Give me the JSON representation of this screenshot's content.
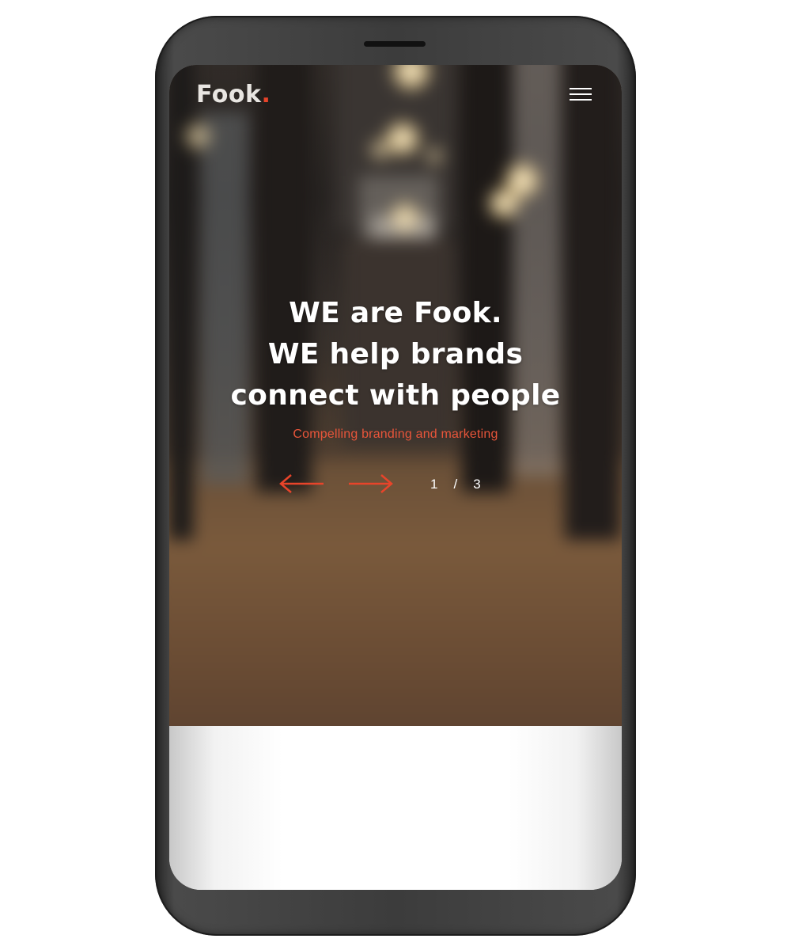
{
  "header": {
    "logo_text": "Fook",
    "logo_dot": "."
  },
  "menu": {
    "icon": "hamburger-menu-icon"
  },
  "hero": {
    "headline_lines": [
      "WE are Fook.",
      "WE help brands",
      "connect with people"
    ],
    "subheadline": "Compelling branding and marketing"
  },
  "slider": {
    "prev_icon": "arrow-left-icon",
    "next_icon": "arrow-right-icon",
    "current": "1",
    "separator": "/",
    "total": "3"
  },
  "colors": {
    "accent": "#e8442a",
    "text_light": "#ffffff",
    "phone_frame": "#3c3c3c"
  }
}
